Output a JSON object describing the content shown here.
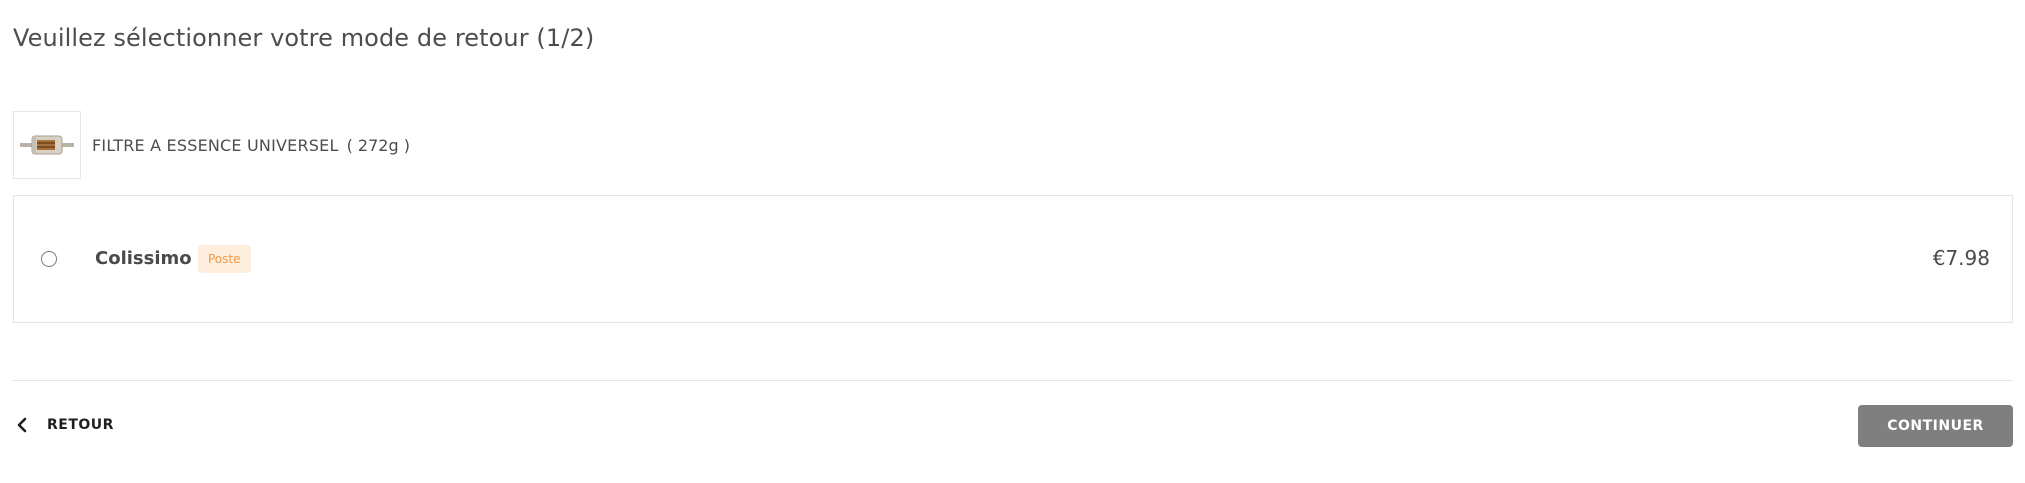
{
  "page": {
    "title": "Veuillez sélectionner votre mode de retour (1/2)"
  },
  "product": {
    "name": "FILTRE A ESSENCE UNIVERSEL",
    "weight": "( 272g )",
    "thumbnail_icon": "fuel-filter-image"
  },
  "shipping_option": {
    "carrier": "Colissimo",
    "badge": "Poste",
    "price": "€7.98",
    "selected": false
  },
  "footer": {
    "back_label": "RETOUR",
    "back_icon": "chevron-left-icon",
    "continue_label": "CONTINUER"
  },
  "colors": {
    "badge_text": "#f2994a",
    "badge_bg": "#fdeedd",
    "continue_bg": "#7f7f7f"
  }
}
